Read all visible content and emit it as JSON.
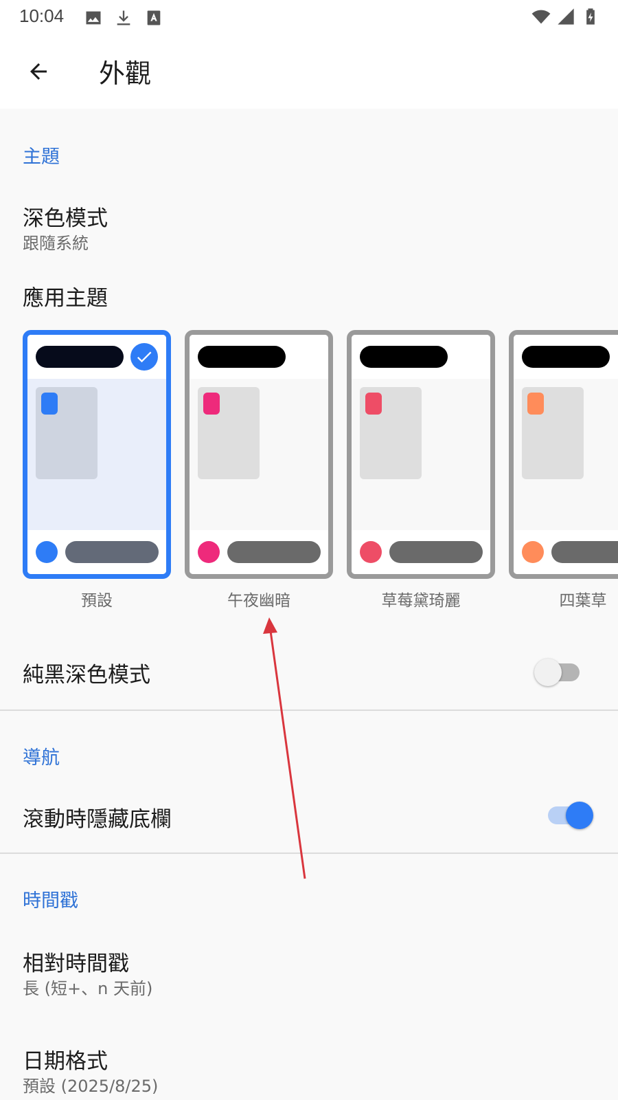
{
  "status_bar": {
    "time": "10:04",
    "left_icons": [
      "image-icon",
      "download-icon",
      "font-icon"
    ],
    "right_icons": [
      "wifi-icon",
      "signal-icon",
      "battery-charging-icon"
    ]
  },
  "app_bar": {
    "title": "外觀",
    "back_icon": "arrow-back-icon"
  },
  "sections": {
    "theme": {
      "header": "主題",
      "dark_mode": {
        "title": "深色模式",
        "summary": "跟隨系統"
      },
      "app_theme": {
        "title": "應用主題",
        "options": [
          {
            "label": "預設",
            "accent": "#2e7cf6",
            "selected": true
          },
          {
            "label": "午夜幽暗",
            "accent": "#ee2a7b",
            "selected": false
          },
          {
            "label": "草莓黛琦麗",
            "accent": "#ee4d66",
            "selected": false
          },
          {
            "label": "四葉草",
            "accent": "#ff8c5a",
            "selected": false
          }
        ]
      },
      "pure_black": {
        "title": "純黑深色模式",
        "enabled": false
      }
    },
    "navigation": {
      "header": "導航",
      "hide_bottom_bar": {
        "title": "滾動時隱藏底欄",
        "enabled": true
      }
    },
    "timestamp": {
      "header": "時間戳",
      "relative": {
        "title": "相對時間戳",
        "summary": "長 (短+、n 天前)"
      },
      "date_format": {
        "title": "日期格式",
        "summary": "預設 (2025/8/25)"
      }
    }
  },
  "colors": {
    "accent": "#2e7cf6",
    "section_header": "#2f72d6",
    "annotation_arrow": "#d9363e"
  }
}
